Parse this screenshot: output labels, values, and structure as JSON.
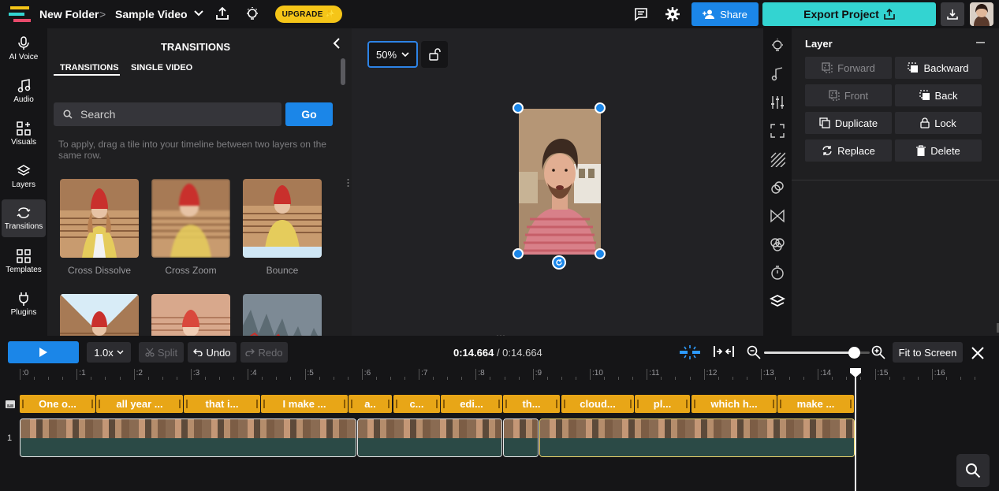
{
  "topbar": {
    "folder": "New Folder",
    "separator": ">",
    "project": "Sample Video",
    "upgrade": "UPGRADE",
    "share": "Share",
    "export": "Export Project"
  },
  "leftnav": [
    {
      "label": "AI Voice",
      "icon": "microphone-icon"
    },
    {
      "label": "Audio",
      "icon": "music-note-icon"
    },
    {
      "label": "Visuals",
      "icon": "visuals-icon"
    },
    {
      "label": "Layers",
      "icon": "layers-icon"
    },
    {
      "label": "Transitions",
      "icon": "transitions-icon"
    },
    {
      "label": "Templates",
      "icon": "templates-icon"
    },
    {
      "label": "Plugins",
      "icon": "plug-icon"
    }
  ],
  "transitions": {
    "title": "TRANSITIONS",
    "tabs": [
      "TRANSITIONS",
      "SINGLE VIDEO"
    ],
    "search_placeholder": "Search",
    "go": "Go",
    "hint": "To apply, drag a tile into your timeline between two layers on the same row.",
    "tiles": [
      "Cross Dissolve",
      "Cross Zoom",
      "Bounce"
    ]
  },
  "canvas": {
    "zoom": "50%"
  },
  "layer": {
    "title": "Layer",
    "buttons": [
      {
        "label": "Forward",
        "disabled": true
      },
      {
        "label": "Backward",
        "disabled": false
      },
      {
        "label": "Front",
        "disabled": true
      },
      {
        "label": "Back",
        "disabled": false
      },
      {
        "label": "Duplicate",
        "disabled": false
      },
      {
        "label": "Lock",
        "disabled": false
      },
      {
        "label": "Replace",
        "disabled": false
      },
      {
        "label": "Delete",
        "disabled": false
      }
    ]
  },
  "timeline": {
    "speed": "1.0x",
    "split": "Split",
    "undo": "Undo",
    "redo": "Redo",
    "current_time": "0:14.664",
    "time_sep": " / ",
    "total_time": "0:14.664",
    "fit": "Fit to Screen",
    "zoom_level": 0.85,
    "ruler": [
      ":0",
      ":1",
      ":2",
      ":3",
      ":4",
      ":5",
      ":6",
      ":7",
      ":8",
      ":9",
      ":10",
      ":11",
      ":12",
      ":13",
      ":14",
      ":15",
      ":16"
    ],
    "track_label": "1",
    "subtitles": [
      "One o...",
      "all year ...",
      "that i...",
      "I make ...",
      "a..",
      "c...",
      "edi...",
      "th...",
      "cloud...",
      "pl...",
      "which h...",
      "make ..."
    ]
  },
  "colors": {
    "accent_blue": "#1b86e8",
    "export_teal": "#33d4d1",
    "upgrade_yellow": "#f5c518",
    "subtitle_orange": "#e8a617"
  }
}
